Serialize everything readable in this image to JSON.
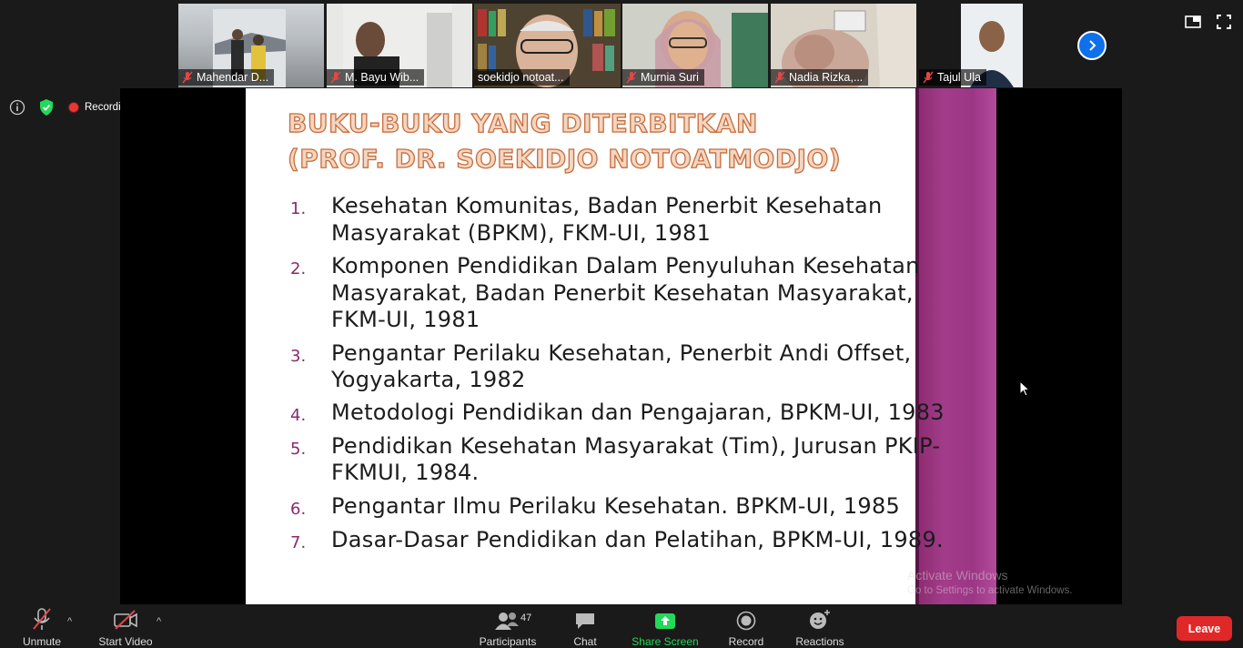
{
  "participants_strip": [
    {
      "name": "Mahendar D...",
      "muted": true
    },
    {
      "name": "M. Bayu Wib...",
      "muted": true
    },
    {
      "name": "soekidjo notoat...",
      "muted": false,
      "speaking": true
    },
    {
      "name": "Murnia Suri",
      "muted": true
    },
    {
      "name": "Nadia Rizka,...",
      "muted": true
    },
    {
      "name": "Tajul Ula",
      "muted": true
    }
  ],
  "status_bar": {
    "recording_label": "Recording"
  },
  "slide": {
    "title_line1": "BUKU-BUKU YANG  DITERBITKAN",
    "title_line2": "(PROF. DR. SOEKIDJO NOTOATMODJO)",
    "items": [
      {
        "num": "1.",
        "lines": [
          "Kesehatan Komunitas, Badan Penerbit Kesehatan",
          "Masyarakat (BPKM), FKM-UI, 1981"
        ]
      },
      {
        "num": "2.",
        "lines": [
          "Komponen Pendidikan Dalam Penyuluhan Kesehatan",
          "Masyarakat, Badan Penerbit Kesehatan Masyarakat,",
          "FKM-UI, 1981"
        ]
      },
      {
        "num": "3.",
        "lines": [
          "Pengantar Perilaku Kesehatan, Penerbit Andi Offset,",
          "Yogyakarta, 1982"
        ]
      },
      {
        "num": "4.",
        "lines": [
          "Metodologi Pendidikan dan Pengajaran, BPKM-UI, 1983"
        ]
      },
      {
        "num": "5.",
        "lines": [
          "Pendidikan Kesehatan Masyarakat (Tim), Jurusan PKIP-",
          "FKMUI, 1984."
        ]
      },
      {
        "num": "6.",
        "lines": [
          "Pengantar Ilmu Perilaku Kesehatan. BPKM-UI, 1985"
        ]
      },
      {
        "num": "7.",
        "lines": [
          "Dasar-Dasar Pendidikan dan Pelatihan, BPKM-UI, 1989."
        ]
      }
    ]
  },
  "watermark": {
    "line1": "Activate Windows",
    "line2": "Go to Settings to activate Windows."
  },
  "toolbar": {
    "unmute": "Unmute",
    "start_video": "Start Video",
    "participants": "Participants",
    "participants_count": "47",
    "chat": "Chat",
    "share_screen": "Share Screen",
    "record": "Record",
    "reactions": "Reactions",
    "leave": "Leave"
  },
  "colors": {
    "accent_green": "#23d959",
    "leave_red": "#e02828",
    "next_blue": "#0e71eb",
    "slide_purple": "#8a2a6f"
  }
}
